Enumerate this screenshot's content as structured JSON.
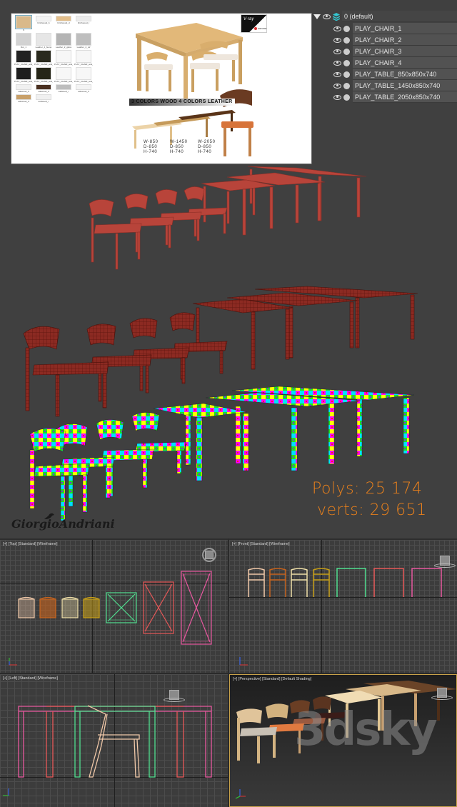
{
  "file_browser": {
    "thumbnails": [
      {
        "caption": "S",
        "kind": "scene",
        "color": "#d9b98a",
        "selected": true
      },
      {
        "caption": "birchwood_b",
        "kind": "strip",
        "color": "#f4f4f4"
      },
      {
        "caption": "birchwood_d",
        "kind": "strip",
        "color": "#e3be8a"
      },
      {
        "caption": "birchwood_r",
        "kind": "strip",
        "color": "#ececec"
      },
      {
        "caption": "Dot_1",
        "kind": "tile",
        "color": "#d2d2d2"
      },
      {
        "caption": "Leather_2_bump",
        "kind": "tile",
        "color": "#e6e6e6"
      },
      {
        "caption": "Leather_2_gloss",
        "kind": "tile",
        "color": "#b4b4b4"
      },
      {
        "caption": "Leather_2_ref",
        "kind": "tile",
        "color": "#bebebe"
      },
      {
        "caption": "PLAY_CHAIR_and_TABLE_Corona",
        "kind": "tile",
        "color": "#222222"
      },
      {
        "caption": "PLAY_CHAIR_and_TABLE_Corona",
        "kind": "tile",
        "color": "#2a2a1e"
      },
      {
        "caption": "PLAY_CHAIR_and_TABLE_Corona.mtl",
        "kind": "doc",
        "color": "#f7f7f7"
      },
      {
        "caption": "PLAY_CHAIR_and_TABLE_Corona.fy",
        "kind": "doc",
        "color": "#f7f7f7"
      },
      {
        "caption": "PLAY_CHAIR_and_TABLE_VRay",
        "kind": "tile",
        "color": "#1e1e1e"
      },
      {
        "caption": "PLAY_CHAIR_and_TABLE_VRay",
        "kind": "tile",
        "color": "#262618"
      },
      {
        "caption": "PLAY_CHAIR_and_TABLE_VRay.mtl",
        "kind": "doc",
        "color": "#f7f7f7"
      },
      {
        "caption": "PLAY_CHAIR_and_TABLE_VRay.fy",
        "kind": "doc",
        "color": "#f7f7f7"
      },
      {
        "caption": "oakwood_b",
        "kind": "strip",
        "color": "#f0f0f0"
      },
      {
        "caption": "oakwood_d",
        "kind": "strip",
        "color": "#4a3020"
      },
      {
        "caption": "oakwood_r",
        "kind": "strip",
        "color": "#bdbdbd"
      },
      {
        "caption": "ashwood_b",
        "kind": "strip",
        "color": "#f4f4f4"
      },
      {
        "caption": "ashwood_d",
        "kind": "strip",
        "color": "#c8a06a"
      },
      {
        "caption": "ashwood_r",
        "kind": "strip",
        "color": "#f0f0f0"
      }
    ]
  },
  "preview": {
    "renderer_badge_vray": "V·ray",
    "renderer_badge_corona": "corona",
    "banner": "3 COLORS WOOD 4 COLORS LEATHER",
    "tables": [
      {
        "w": "W-850",
        "d": "D-850",
        "h": "H-740"
      },
      {
        "w": "W-1450",
        "d": "D-850",
        "h": "H-740"
      },
      {
        "w": "W-2050",
        "d": "D-850",
        "h": "H-740"
      }
    ]
  },
  "layers": {
    "root": "0 (default)",
    "items": [
      "PLAY_CHAIR_1",
      "PLAY_CHAIR_2",
      "PLAY_CHAIR_3",
      "PLAY_CHAIR_4",
      "PLAY_TABLE_850x850x740",
      "PLAY_TABLE_1450x850x740",
      "PLAY_TABLE_2050x850x740"
    ]
  },
  "stats": {
    "polys_label": "Polys: 25 174",
    "verts_label": "verts: 29 651"
  },
  "signature": "GiorgioAndriani",
  "viewports": {
    "top": "[+] [Top] [Standard] [Wireframe]",
    "front": "[+] [Front] [Standard] [Wireframe]",
    "left": "[+] [Left] [Standard] [Wireframe]",
    "perspective": "[+] [Perspective] [Standard] [Default Shading]"
  },
  "object_colors": {
    "chair_1": "#f0c8a8",
    "chair_2": "#c8641e",
    "chair_3": "#f0e0a8",
    "chair_4": "#c8a018",
    "table_850": "#50e090",
    "table_1450": "#e85858",
    "table_2050": "#e858a0",
    "clay": "#b8443a",
    "stats_orange": "#e8801c"
  },
  "watermark": "3dsky"
}
